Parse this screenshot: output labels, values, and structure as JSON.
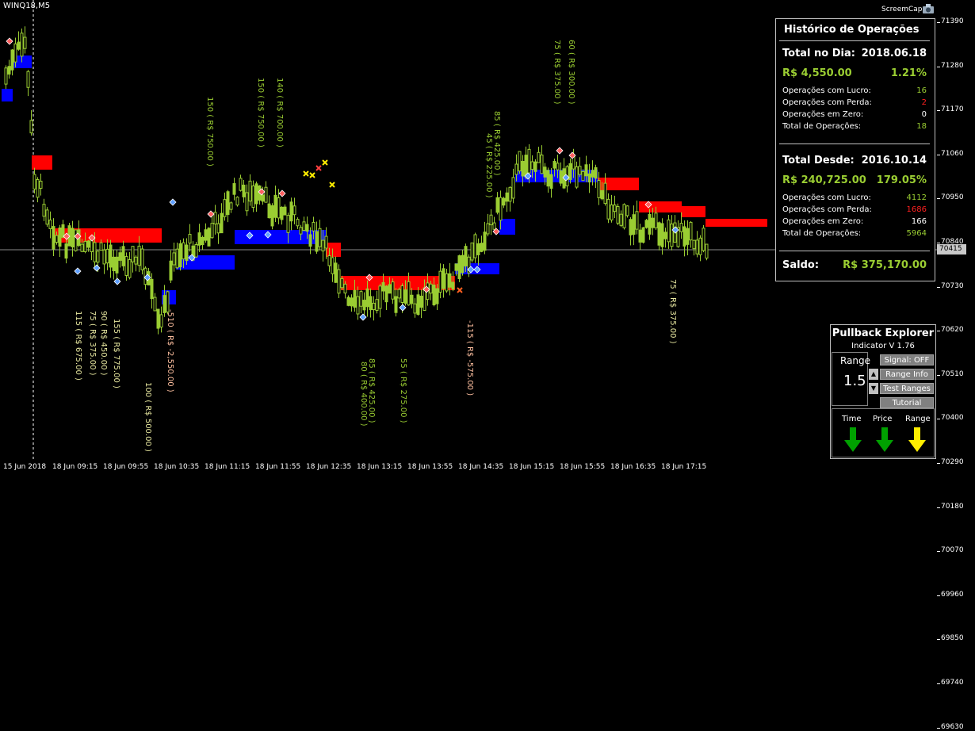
{
  "chart": {
    "symbol": "WINQ18,M5",
    "screencap_label": "ScreemCap",
    "price_ticks": [
      "71390",
      "71280",
      "71170",
      "71060",
      "70950",
      "70840",
      "70730",
      "70620",
      "70510",
      "70400",
      "70290",
      "70180",
      "70070",
      "69960",
      "69850",
      "69740",
      "69630"
    ],
    "current_price": "70415",
    "time_labels": [
      "15 Jun 2018",
      "18 Jun 09:15",
      "18 Jun 09:55",
      "18 Jun 10:35",
      "18 Jun 11:15",
      "18 Jun 11:55",
      "18 Jun 12:35",
      "18 Jun 13:15",
      "18 Jun 13:55",
      "18 Jun 14:35",
      "18 Jun 15:15",
      "18 Jun 15:55",
      "18 Jun 16:35",
      "18 Jun 17:15"
    ],
    "trade_annotations": [
      "115 ( R$ 675.00 )",
      "75 ( R$ 375.00 )",
      "90 ( R$ 450.00 )",
      "155 ( R$ 775.00 )",
      "100 ( R$ 500.00 )",
      "-510 ( R$ -2,550.00 )",
      "150 ( R$ 750.00 )",
      "150 ( R$ 750.00 )",
      "140 ( R$ 700.00 )",
      "85 ( R$ 425.00 )",
      "80 ( R$ 400.00 )",
      "55 ( R$ 275.00 )",
      "-115 ( R$ -575.00 )",
      "45 ( R$ 225.00 )",
      "85 ( R$ 425.00 )",
      "75 ( R$ 375.00 )",
      "60 ( R$ 300.00 )",
      "75 ( R$ 375.00 )"
    ]
  },
  "historico": {
    "title": "Histórico de Operações",
    "dia_label": "Total no Dia:",
    "dia_date": "2018.06.18",
    "dia_value": "R$ 4,550.00",
    "dia_pct": "1.21%",
    "dia_rows": [
      {
        "label": "Operações com Lucro:",
        "value": "16",
        "color": "#9acd32"
      },
      {
        "label": "Operações com Perda:",
        "value": "2",
        "color": "#ff2020"
      },
      {
        "label": "Operações em Zero:",
        "value": "0",
        "color": "#ffffff"
      },
      {
        "label": "Total de Operações:",
        "value": "18",
        "color": "#9acd32"
      }
    ],
    "desde_label": "Total Desde:",
    "desde_date": "2016.10.14",
    "desde_value": "R$ 240,725.00",
    "desde_pct": "179.05%",
    "desde_rows": [
      {
        "label": "Operações com Lucro:",
        "value": "4112",
        "color": "#9acd32"
      },
      {
        "label": "Operações com Perda:",
        "value": "1686",
        "color": "#ff2020"
      },
      {
        "label": "Operações em Zero:",
        "value": "166",
        "color": "#ffffff"
      },
      {
        "label": "Total de Operações:",
        "value": "5964",
        "color": "#9acd32"
      }
    ],
    "saldo_label": "Saldo:",
    "saldo_value": "R$ 375,170.00"
  },
  "pullback": {
    "title": "Pullback Explorer",
    "subtitle": "Indicator V 1.76",
    "range_label": "Range",
    "range_value": "1.5",
    "btn_signal": "Signal: OFF",
    "btn_range_info": "Range Info",
    "btn_test_ranges": "Test Ranges",
    "btn_tutorial": "Tutorial",
    "ind_time": "Time",
    "ind_price": "Price",
    "ind_range": "Range",
    "arrow_colors": {
      "time": "#00a000",
      "price": "#00a000",
      "range": "#ffee00"
    }
  }
}
